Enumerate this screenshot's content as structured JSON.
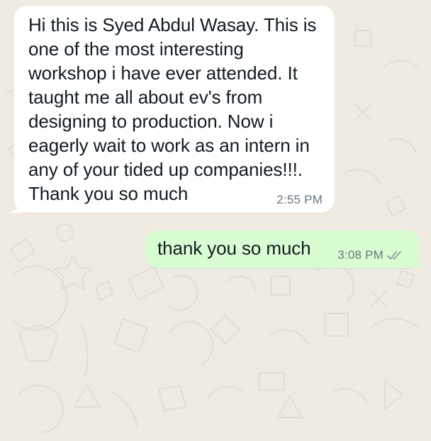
{
  "conversation": {
    "messages": [
      {
        "direction": "incoming",
        "text": "Hi this is Syed Abdul Wasay. This is\none of the most interesting\nworkshop i have ever attended. It\ntaught me all about ev's from\ndesigning to production. Now i\neagerly wait to work as an intern in\nany of your tided up companies!!!.\nThank you so much",
        "time": "2:55 PM"
      },
      {
        "direction": "outgoing",
        "text": "thank you so much",
        "time": "3:08 PM",
        "status_icon": "double-check-read-icon"
      }
    ]
  },
  "theme": {
    "background": "#efeae2",
    "incoming_bubble": "#ffffff",
    "outgoing_bubble": "#d9fdd3",
    "text": "#111b21",
    "meta": "#667781"
  }
}
